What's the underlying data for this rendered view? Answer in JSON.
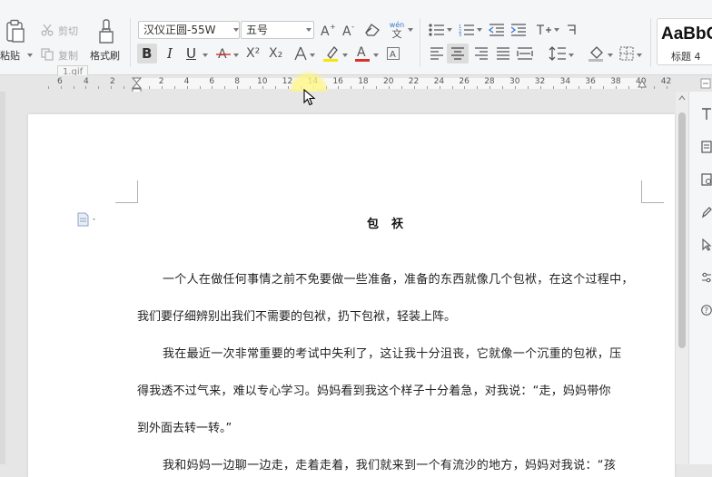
{
  "clipboard": {
    "paste_label": "粘贴",
    "cut_label": "剪切",
    "copy_label": "复制",
    "format_painter_label": "格式刷"
  },
  "font": {
    "family": "汉仪正圆-55W",
    "size": "五号",
    "bold_label": "B",
    "italic_label": "I",
    "underline_label": "U",
    "superscript_label": "X²",
    "subscript_label": "X₂",
    "phonetic_label": "wén"
  },
  "styles": {
    "sample_text": "AaBbC",
    "name": "标题 4"
  },
  "tooltip": "1.gif",
  "ruler": {
    "left_labels": [
      "6",
      "4",
      "2"
    ],
    "labels": [
      "2",
      "4",
      "6",
      "8",
      "10",
      "12",
      "14",
      "16",
      "18",
      "20",
      "22",
      "24",
      "26",
      "28",
      "30",
      "32",
      "34",
      "36",
      "38",
      "40",
      "42"
    ]
  },
  "document": {
    "title": "包祆",
    "lines": [
      "一个人在做任何事情之前不免要做一些准备，准备的东西就像几个包袱，在这个过程中，",
      "我们要仔细辨别出我们不需要的包袱，扔下包袱，轻装上阵。",
      "我在最近一次非常重要的考试中失利了，这让我十分沮丧，它就像一个沉重的包袱，压",
      "得我透不过气来，难以专心学习。妈妈看到我这个样子十分着急，对我说：“走，妈妈带你",
      "到外面去转一转。”",
      "我和妈妈一边聊一边走，走着走着，我们就来到一个有流沙的地方，妈妈对我说：“孩"
    ]
  },
  "colors": {
    "accent_blue": "#3c78d8",
    "font_color_red": "#d9302c",
    "highlight_yellow": "#f7e600"
  }
}
